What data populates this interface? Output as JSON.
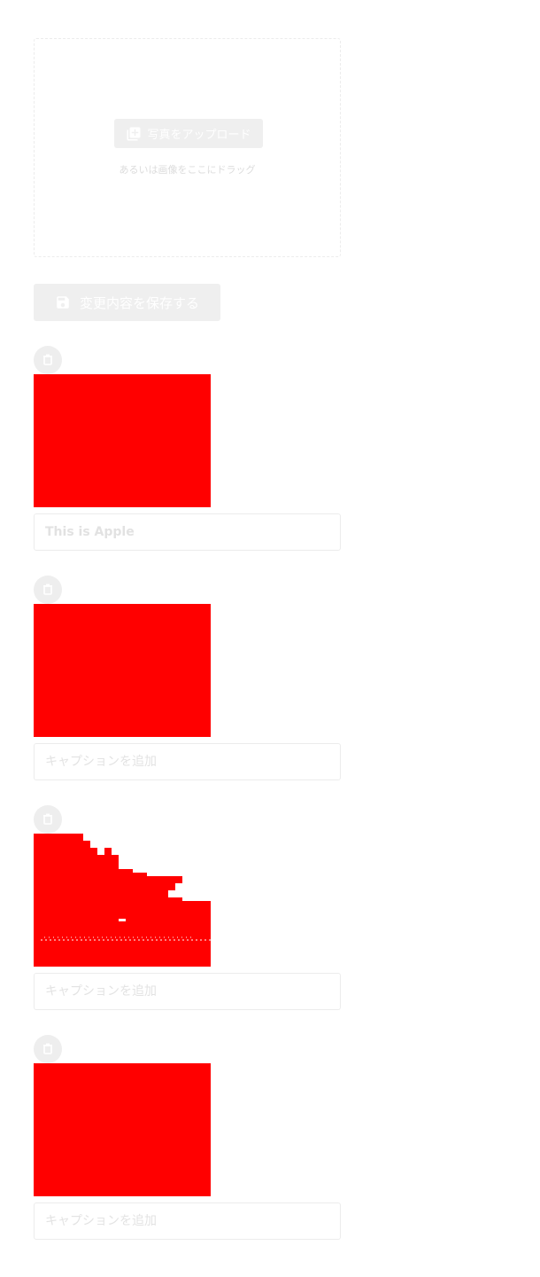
{
  "uploader": {
    "upload_button_label": "写真をアップロード",
    "drag_hint": "あるいは画像をここにドラッグ",
    "upload_icon": "add-photo-icon"
  },
  "toolbar": {
    "save_label": "変更内容を保存する",
    "save_icon": "floppy-disk-icon"
  },
  "photos": [
    {
      "delete_icon": "trash-icon",
      "thumbnail_color": "#ff0000",
      "caption_value": "This is Apple",
      "caption_placeholder": "キャプションを追加"
    },
    {
      "delete_icon": "trash-icon",
      "thumbnail_color": "#ff0000",
      "caption_value": "",
      "caption_placeholder": "キャプションを追加"
    },
    {
      "delete_icon": "trash-icon",
      "thumbnail_color": "#ff0000",
      "caption_value": "",
      "caption_placeholder": "キャプションを追加"
    },
    {
      "delete_icon": "trash-icon",
      "thumbnail_color": "#ff0000",
      "caption_value": "",
      "caption_placeholder": "キャプションを追加"
    }
  ],
  "colors": {
    "button_bg": "#efefef",
    "border": "#ececec",
    "thumbnail": "#ff0000"
  }
}
